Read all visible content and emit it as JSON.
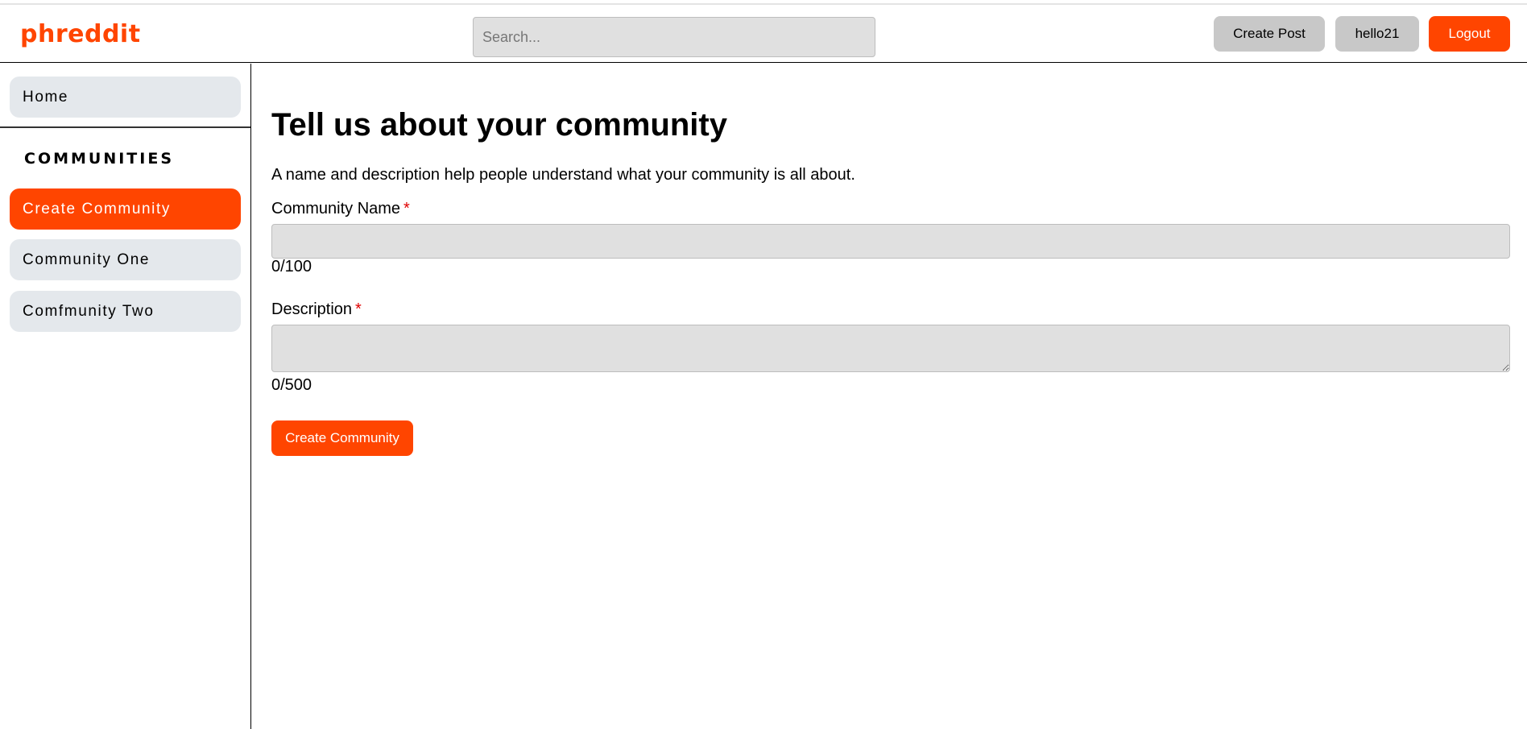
{
  "app": {
    "logo": "phreddit"
  },
  "header": {
    "search_placeholder": "Search...",
    "create_post_label": "Create Post",
    "username": "hello21",
    "logout_label": "Logout"
  },
  "sidebar": {
    "home_label": "Home",
    "communities_header": "COMMUNITIES",
    "create_community_label": "Create Community",
    "communities": [
      {
        "label": "Community One"
      },
      {
        "label": "Comfmunity Two"
      }
    ]
  },
  "form": {
    "title": "Tell us about your community",
    "subtitle": "A name and description help people understand what your community is all about.",
    "name_label": "Community Name",
    "name_value": "",
    "name_counter": "0/100",
    "description_label": "Description",
    "description_value": "",
    "description_counter": "0/500",
    "required_marker": "*",
    "submit_label": "Create Community"
  },
  "colors": {
    "accent": "#ff4500",
    "nav_item_bg": "#e4e8ec",
    "input_bg": "#e0e0e0",
    "button_grey": "#c8c8c8",
    "required": "#e00000"
  }
}
